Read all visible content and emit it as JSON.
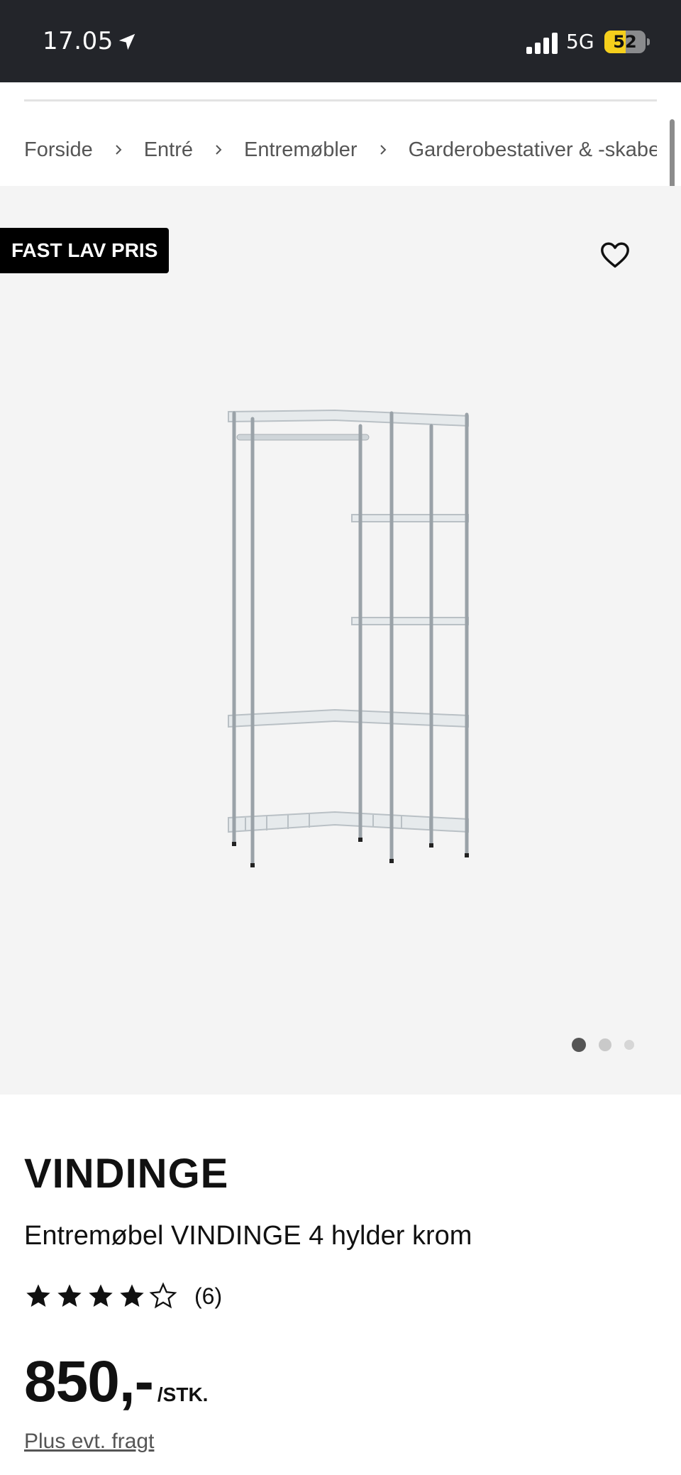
{
  "status_bar": {
    "time": "17.05",
    "network": "5G",
    "battery": "52",
    "battery_level": 0.52
  },
  "breadcrumb": {
    "items": [
      "Forside",
      "Entré",
      "Entremøbler",
      "Garderobestativer & -skabe"
    ]
  },
  "gallery": {
    "badge": "FAST LAV PRIS",
    "slide_count": 3,
    "active_slide": 1
  },
  "product": {
    "brand": "VINDINGE",
    "title": "Entremøbel VINDINGE 4 hylder krom",
    "rating": 4,
    "rating_max": 5,
    "review_count": "(6)",
    "price": "850,-",
    "unit": "/STK.",
    "shipping_note": "Plus evt. fragt"
  },
  "colors": {
    "status_bar": "#23252a",
    "gallery_bg": "#f4f4f4",
    "badge_bg": "#000000",
    "battery": "#f5cf1c"
  }
}
